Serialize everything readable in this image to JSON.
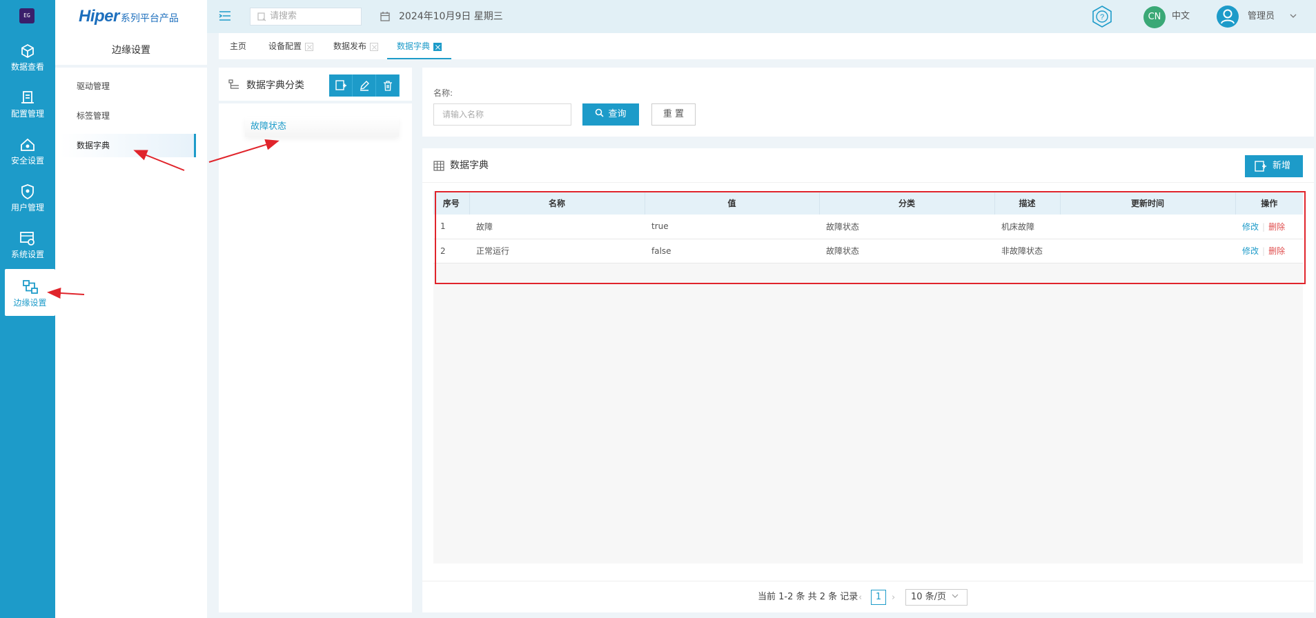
{
  "rail": {
    "logo_text": "EG",
    "items": [
      {
        "label": "数据查看",
        "icon": "cube-icon"
      },
      {
        "label": "配置管理",
        "icon": "config-icon"
      },
      {
        "label": "安全设置",
        "icon": "security-icon"
      },
      {
        "label": "用户管理",
        "icon": "user-shield-icon"
      },
      {
        "label": "系统设置",
        "icon": "system-icon"
      },
      {
        "label": "边缘设置",
        "icon": "edge-icon",
        "active": true
      }
    ]
  },
  "brand": {
    "main": "Hiper",
    "sub": "系列平台产品"
  },
  "sidebar": {
    "title": "边缘设置",
    "items": [
      {
        "label": "驱动管理"
      },
      {
        "label": "标签管理"
      },
      {
        "label": "数据字典",
        "active": true
      }
    ]
  },
  "topbar": {
    "search_placeholder": "请搜索",
    "date": "2024年10月9日 星期三",
    "lang_badge": "CN",
    "lang": "中文",
    "user": "管理员"
  },
  "tabs": [
    {
      "label": "主页",
      "closable": false
    },
    {
      "label": "设备配置",
      "closable": true
    },
    {
      "label": "数据发布",
      "closable": true
    },
    {
      "label": "数据字典",
      "closable": true,
      "active": true
    }
  ],
  "category": {
    "title": "数据字典分类",
    "tree_items": [
      "故障状态"
    ]
  },
  "query": {
    "name_label": "名称:",
    "name_placeholder": "请输入名称",
    "search_label": "查询",
    "reset_label": "重 置"
  },
  "data_panel": {
    "title": "数据字典",
    "add_label": "新增",
    "columns": [
      "序号",
      "名称",
      "值",
      "分类",
      "描述",
      "更新时间",
      "操作"
    ],
    "rows": [
      {
        "no": "1",
        "name": "故障",
        "value": "true",
        "category": "故障状态",
        "desc": "机床故障",
        "updated": "",
        "edit": "修改",
        "del": "删除"
      },
      {
        "no": "2",
        "name": "正常运行",
        "value": "false",
        "category": "故障状态",
        "desc": "非故障状态",
        "updated": "",
        "edit": "修改",
        "del": "删除"
      }
    ],
    "pagination": {
      "summary": "当前 1-2 条 共 2 条 记录",
      "current_page": "1",
      "page_size": "10 条/页"
    }
  },
  "colors": {
    "primary": "#1d9bc9",
    "annotation": "#e0242b",
    "danger": "#e05050"
  }
}
